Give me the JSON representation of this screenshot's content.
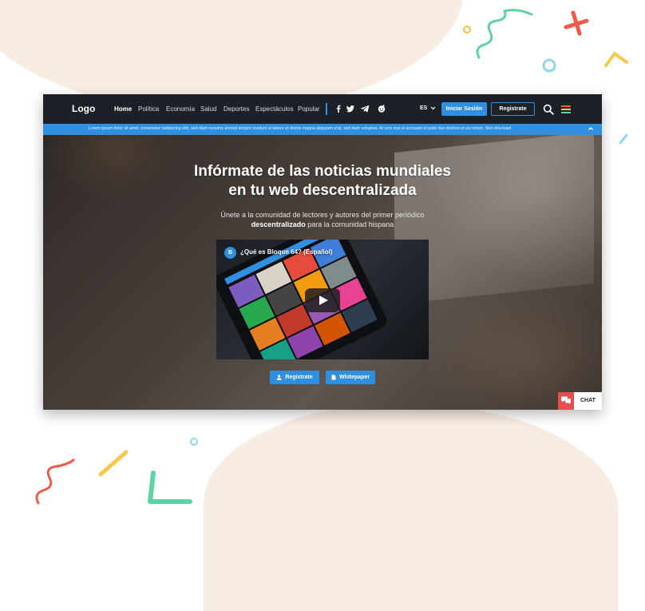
{
  "navbar": {
    "logo": "Logo",
    "items": [
      "Home",
      "Política",
      "Economía",
      "Salud",
      "Deportes",
      "Espectáculos",
      "Popular"
    ],
    "lang": "ES",
    "login_label": "Iniciar Sesión",
    "register_label": "Registrate"
  },
  "banner": {
    "text": "Lorem ipsum dolor sit amet, consetetur sadipscing elitr, sed diam nonumy eirmod tempor invidunt ut labore et dolore magna aliquyam erat, sed diam voluptua. At vero eos et accusam et justo duo dolores et ea rebum. Stet clita kasd."
  },
  "hero": {
    "title_line1": "Infórmate de las noticias mundiales",
    "title_line2": "en tu web descentralizada",
    "subtitle_line1": "Únete a la comunidad de lectores y autores del primer periódico",
    "subtitle_bold": "descentralizado",
    "subtitle_rest": " para la comunidad hispana"
  },
  "video": {
    "channel_initial": "B",
    "title": "¿Qué es Bloque 64? (Español)"
  },
  "cta": {
    "register_label": "Registrate",
    "whitepaper_label": "Whitepaper"
  },
  "chat": {
    "label": "CHAT"
  },
  "colors": {
    "accent": "#2f8fe0",
    "navbar": "#1d2127",
    "chat": "#e84e4e"
  }
}
